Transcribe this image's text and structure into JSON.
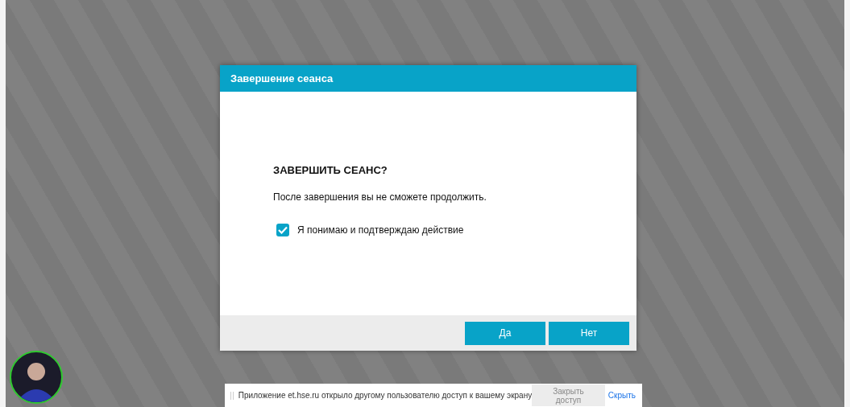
{
  "dialog": {
    "title": "Завершение сеанса",
    "heading": "ЗАВЕРШИТЬ СЕАНС?",
    "message": "После завершения вы не сможете продолжить.",
    "confirm": {
      "label": "Я понимаю и подтверждаю действие",
      "checked": true
    },
    "buttons": [
      {
        "label": "Да"
      },
      {
        "label": "Нет"
      }
    ]
  },
  "camera": {
    "active": true
  },
  "share_bar": {
    "message": "Приложение et.hse.ru открыло другому пользователю доступ к вашему экрану",
    "stop_button": "Закрыть доступ",
    "hide_link": "Скрыть"
  }
}
